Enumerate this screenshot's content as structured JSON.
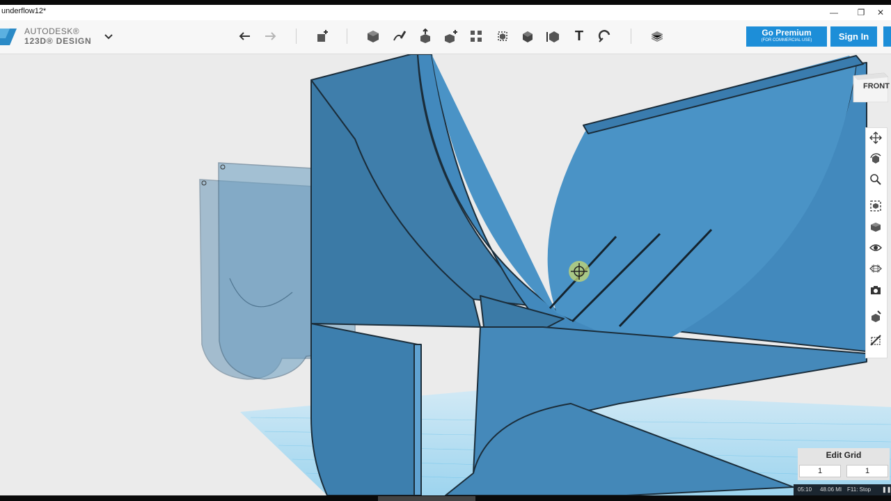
{
  "window": {
    "title": "underflow12*",
    "controls": {
      "minimize": "—",
      "maximize": "❐",
      "close": "✕"
    }
  },
  "app": {
    "logo_line1": "AUTODESK®",
    "logo_line2": "123D® DESIGN",
    "brand_color": "#1d8ed8"
  },
  "toolbar": {
    "tools": [
      "undo-icon",
      "redo-icon",
      "transform-icon",
      "primitives-icon",
      "sketch-icon",
      "construct-icon",
      "modify-icon",
      "pattern-icon",
      "grouping-icon",
      "combine-icon",
      "measure-icon",
      "text-icon",
      "snap-icon",
      "material-icon"
    ],
    "text_tool_glyph": "T"
  },
  "account": {
    "premium_label": "Go Premium",
    "premium_sub": "(FOR COMMERCIAL USE)",
    "signin_label": "Sign In"
  },
  "viewcube": {
    "face": "FRONT"
  },
  "navigation": [
    "pan-icon",
    "orbit-icon",
    "zoom-icon",
    "fit-icon",
    "views-icon",
    "visibility-icon",
    "material-display-icon",
    "screenshot-icon",
    "snap-grid-icon",
    "hide-icon"
  ],
  "edit_grid": {
    "label": "Edit Grid",
    "value_x": "1",
    "value_y": "1"
  },
  "status_bar": {
    "time": "05:10",
    "size": "48.06 MI",
    "recorder": "F11: Stop"
  },
  "model_color": "#3d86b8"
}
